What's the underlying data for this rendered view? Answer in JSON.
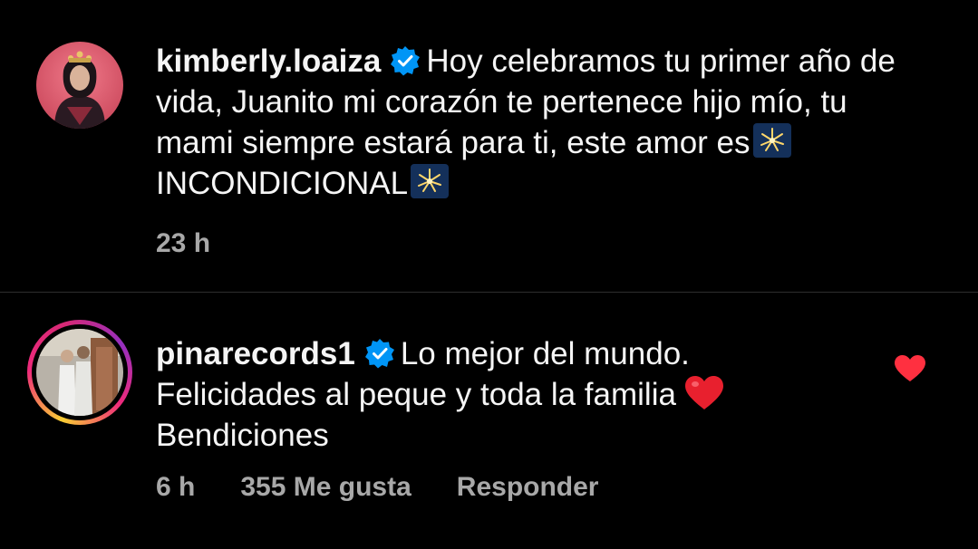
{
  "comments": [
    {
      "username": "kimberly.loaiza",
      "verified": true,
      "avatar": "kimberly-avatar",
      "text_part1": "Hoy celebramos tu primer año de vida, Juanito mi corazón te pertenece hijo mío, tu mami siempre estará para ti, este amor es",
      "text_part2": "INCONDICIONAL",
      "emoji": "sparkler-emoji",
      "time": "23 h"
    },
    {
      "username": "pinarecords1",
      "verified": true,
      "avatar": "pinarecords-avatar",
      "text_part1": "Lo mejor del mundo. Felicidades al peque y toda la familia",
      "text_part2": "Bendiciones",
      "emoji": "red-heart-emoji",
      "time": "6 h",
      "likes": "355 Me gusta",
      "reply_label": "Responder",
      "liked": true
    }
  ],
  "colors": {
    "background": "#000000",
    "text": "#f5f5f5",
    "meta": "#a8a8a8",
    "verified": "#0095f6",
    "like": "#ff3040"
  }
}
